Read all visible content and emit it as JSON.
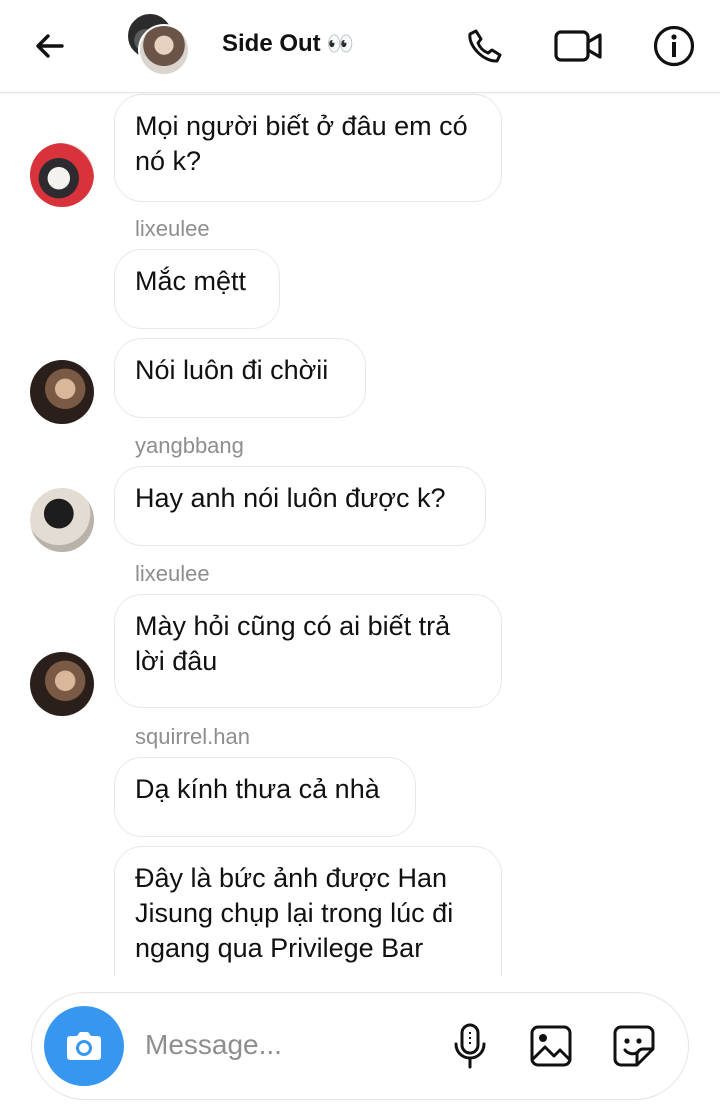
{
  "header": {
    "title": "Side Out",
    "title_emoji": "👀"
  },
  "messages": [
    {
      "sender": "",
      "text": "Mọi người biết ở đâu em có nó k?"
    },
    {
      "sender": "lixeulee",
      "text": "Mắc mệtt"
    },
    {
      "sender": "",
      "text": "Nói luôn đi chờii"
    },
    {
      "sender": "yangbbang",
      "text": "Hay anh nói luôn được k?"
    },
    {
      "sender": "lixeulee",
      "text": "Mày hỏi cũng có ai biết trả lời đâu"
    },
    {
      "sender": "squirrel.han",
      "text": "Dạ kính thưa cả nhà"
    },
    {
      "sender": "",
      "text": "Đây là bức ảnh được Han Jisung chụp lại trong lúc đi ngang qua Privilege Bar"
    }
  ],
  "composer": {
    "placeholder": "Message...",
    "value": ""
  },
  "icons": {
    "back": "arrow-left-icon",
    "call": "phone-icon",
    "video": "video-camera-icon",
    "info": "info-icon",
    "camera": "camera-icon",
    "mic": "microphone-icon",
    "gallery": "image-icon",
    "sticker": "sticker-icon"
  },
  "colors": {
    "accent": "#3797f0",
    "bubble_border": "#e8e8e8",
    "sender_text": "#8e8e8e"
  }
}
